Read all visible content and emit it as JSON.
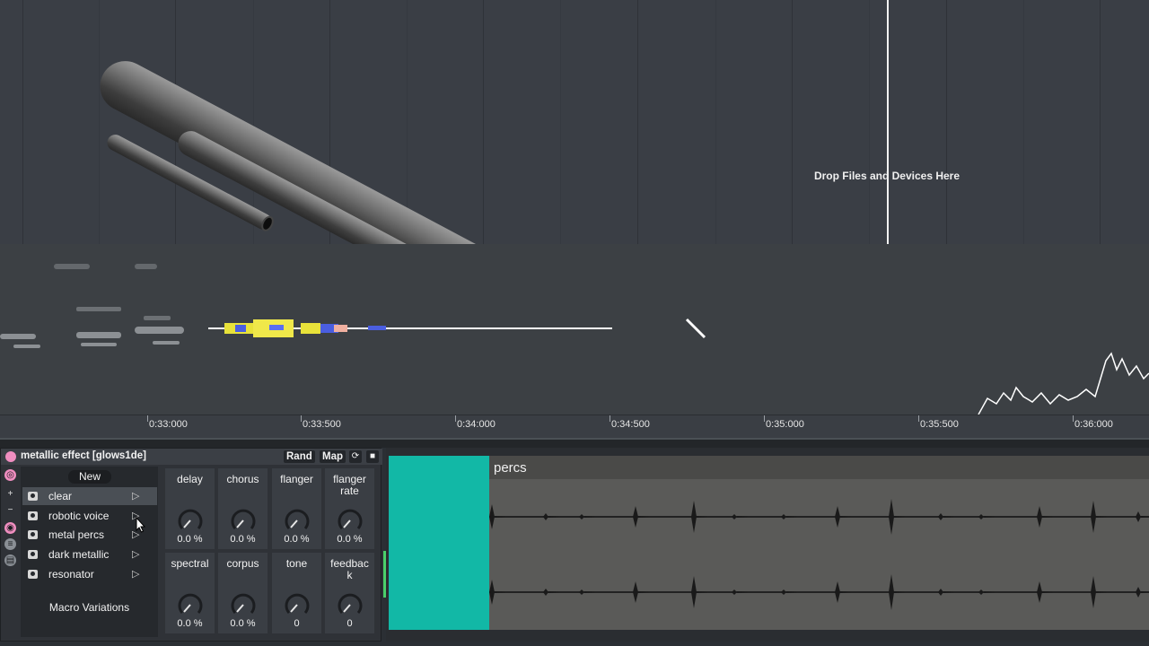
{
  "arrangement": {
    "drop_label": "Drop Files and Devices Here"
  },
  "ruler": {
    "times": [
      "0:33:000",
      "0:33:500",
      "0:34:000",
      "0:34:500",
      "0:35:000",
      "0:35:500",
      "0:36:000"
    ]
  },
  "device": {
    "title": "metallic effect [glows1de]",
    "rand_label": "Rand",
    "map_label": "Map",
    "new_label": "New",
    "variations": [
      {
        "label": "clear"
      },
      {
        "label": "robotic voice"
      },
      {
        "label": "metal percs"
      },
      {
        "label": "dark metallic"
      },
      {
        "label": "resonator"
      }
    ],
    "macro_variations_label": "Macro Variations",
    "macros": [
      {
        "label": "delay",
        "value": "0.0 %"
      },
      {
        "label": "chorus",
        "value": "0.0 %"
      },
      {
        "label": "flanger",
        "value": "0.0 %"
      },
      {
        "label": "flanger\nrate",
        "value": "0.0 %"
      },
      {
        "label": "spectral",
        "value": "0.0 %"
      },
      {
        "label": "corpus",
        "value": "0.0 %"
      },
      {
        "label": "tone",
        "value": "0"
      },
      {
        "label": "feedbac\nk",
        "value": "0"
      }
    ]
  },
  "clip": {
    "name": "percs"
  },
  "colors": {
    "accent_pink": "#f08ec0",
    "clip_teal": "#12b8a6"
  }
}
